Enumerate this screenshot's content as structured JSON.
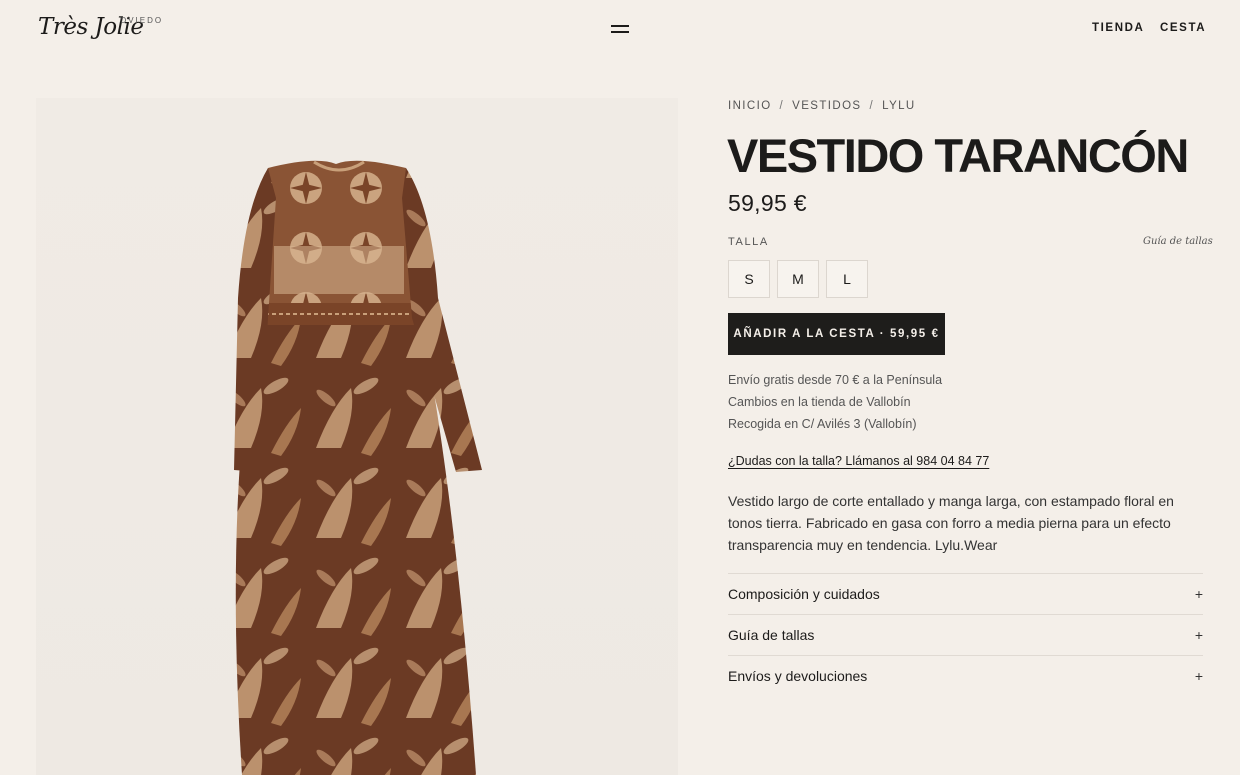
{
  "header": {
    "logo": "Très Jolie",
    "logo_sub": "OVIEDO",
    "nav": [
      "TIENDA",
      "CESTA"
    ]
  },
  "breadcrumb": [
    "INICIO",
    "VESTIDOS",
    "LYLU"
  ],
  "product": {
    "title": "VESTIDO TARANCÓN",
    "price": "59,95 €",
    "size_label": "TALLA",
    "size_guide_link": "Guía de tallas",
    "sizes": [
      "S",
      "M",
      "L"
    ],
    "add_to_cart": "AÑADIR A LA CESTA · 59,95 €",
    "info_lines": [
      "Envío gratis desde 70 € a la Península",
      "Cambios en la tienda de Vallobín",
      "Recogida en C/ Avilés 3 (Vallobín)"
    ],
    "phone_link": "¿Dudas con la talla? Llámanos al 984 04 84 77",
    "description": "Vestido largo de corte entallado y manga larga, con estampado floral en tonos tierra. Fabricado en gasa con forro a media pierna para un efecto transparencia muy en tendencia. Lylu.Wear",
    "accordion": [
      {
        "label": "Composición y cuidados",
        "icon": "+"
      },
      {
        "label": "Guía de tallas",
        "icon": "+"
      },
      {
        "label": "Envíos y devoluciones",
        "icon": "+"
      }
    ]
  },
  "colors": {
    "background": "#f4efe9",
    "text": "#1c1b1a",
    "button": "#1e1d1b",
    "dress_dark": "#6b3a24",
    "dress_light": "#c9a07a"
  }
}
